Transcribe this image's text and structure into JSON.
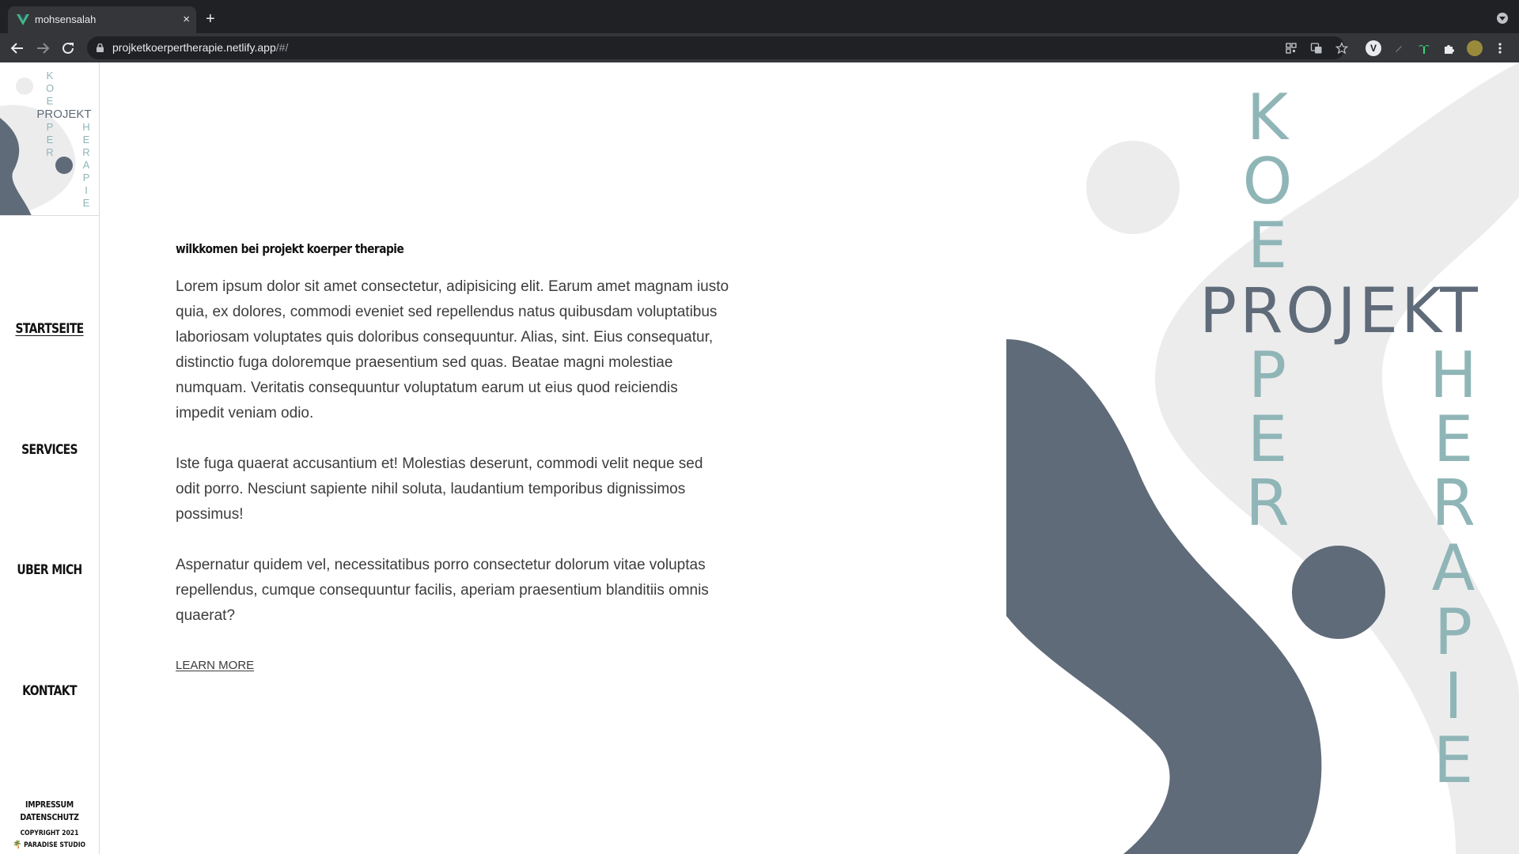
{
  "browser": {
    "tab_title": "mohsensalah",
    "tab_close": "×",
    "new_tab": "+",
    "url_host": "projketkoerpertherapie.netlify.app",
    "url_path": "/#/",
    "icons": [
      "back-arrow-icon",
      "forward-arrow-icon",
      "reload-icon",
      "lock-icon",
      "qr-code-icon",
      "translate-icon",
      "star-icon",
      "extensions"
    ]
  },
  "logo": {
    "word_projekt": "PROJEKT",
    "vertical_koerper": [
      "K",
      "O",
      "E",
      "P",
      "E",
      "R"
    ],
    "vertical_therapie": [
      "H",
      "E",
      "R",
      "A",
      "P",
      "I",
      "E"
    ]
  },
  "nav": {
    "items": [
      "STARTSEITE",
      "SERVICES",
      "UBER MICH",
      "KONTAKT"
    ],
    "active": "STARTSEITE"
  },
  "footer": {
    "impressum": "IMPRESSUM",
    "datenschutz": "DATENSCHUTZ",
    "copyright": "COPYRIGHT 2021",
    "studio": "PARADISE STUDIO"
  },
  "main": {
    "welcome": "wilkkomen bei projekt koerper therapie",
    "paragraphs": [
      "Lorem ipsum dolor sit amet consectetur, adipisicing elit. Earum amet magnam iusto quia, ex dolores, commodi eveniet sed repellendus natus quibusdam voluptatibus laboriosam voluptates quis doloribus consequuntur. Alias, sint. Eius consequatur, distinctio fuga doloremque praesentium sed quas. Beatae magni molestiae numquam. Veritatis consequuntur voluptatum earum ut eius quod reiciendis impedit veniam odio.",
      "Iste fuga quaerat accusantium et! Molestias deserunt, commodi velit neque sed odit porro. Nesciunt sapiente nihil soluta, laudantium temporibus dignissimos possimus!",
      "Aspernatur quidem vel, necessitatibus porro consectetur dolorum vitae voluptas repellendus, cumque consequuntur facilis, aperiam praesentium blanditiis omnis quaerat?"
    ],
    "learn_more": "LEARN MORE"
  },
  "hero": {
    "word_projekt": "PROJEKT",
    "vertical_koerper": [
      "K",
      "O",
      "E",
      "P",
      "E",
      "R"
    ],
    "vertical_therapie": [
      "H",
      "E",
      "R",
      "A",
      "P",
      "I",
      "E"
    ]
  },
  "colors": {
    "slate": "#5f6b79",
    "teal": "#8fb5b7",
    "light_gray": "#ececed",
    "chrome_dark": "#202124"
  }
}
